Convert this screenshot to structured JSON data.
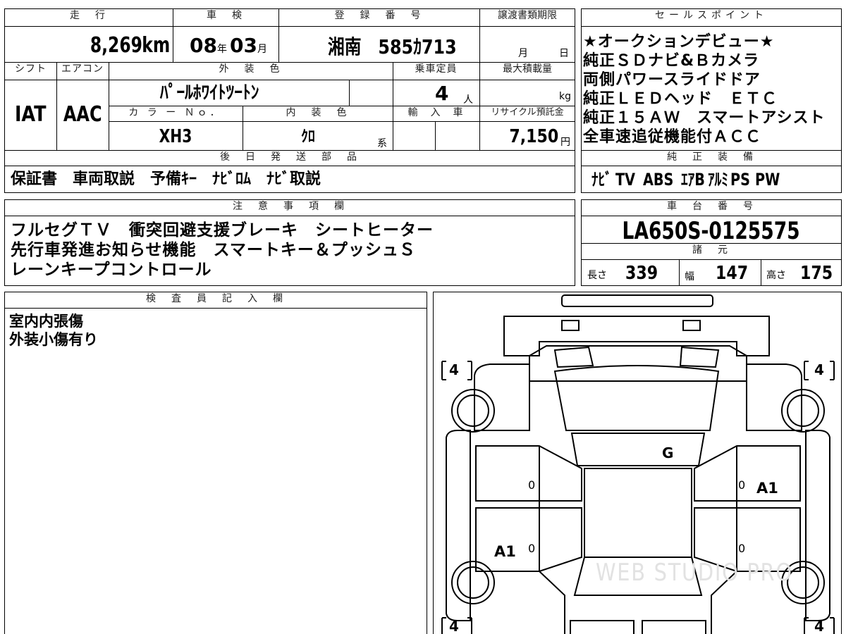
{
  "top": {
    "mileage_h": "走　行",
    "mileage_value": "8,269",
    "mileage_unit": "km",
    "inspect_h": "車　検",
    "inspect_year": "08",
    "inspect_year_unit": "年",
    "inspect_month": "03",
    "inspect_month_unit": "月",
    "reg_h": "登　録　番　号",
    "reg_value": "湘南　585ｶ713",
    "transfer_h": "譲渡書類期限",
    "transfer_month": "月",
    "transfer_day": "日",
    "shift_h": "シフト",
    "shift_value": "IAT",
    "ac_h": "エアコン",
    "ac_value": "AAC",
    "exterior_h": "外　装　色",
    "exterior_value": "ﾊﾟｰﾙﾎﾜｲﾄﾂｰﾄﾝ",
    "capacity_h": "乗車定員",
    "capacity_value": "4",
    "capacity_unit": "人",
    "maxload_h": "最大積載量",
    "maxload_unit": "kg",
    "colorno_h": "カ ラ ー Ｎｏ．",
    "colorno_value": "XH3",
    "interior_h": "内　装　色",
    "interior_value": "ｸﾛ",
    "interior_unit": "系",
    "import_h": "輸　入　車",
    "recycle_h": "リサイクル預託金",
    "recycle_value": "7,150",
    "recycle_unit": "円",
    "later_h": "後　日　発　送　部　品",
    "later_value": "保証書　車両取説　予備ｷｰ　ﾅﾋﾞﾛﾑ　ﾅﾋﾞ取説"
  },
  "sales": {
    "header": "セールスポイント",
    "lines": [
      "★オークションデビュー★",
      "純正ＳＤナビ&Ｂカメラ",
      "両側パワースライドドア",
      "純正ＬＥＤヘッド　ＥＴＣ",
      "純正１５ＡＷ　スマートアシスト",
      "全車速追従機能付ＡＣＣ"
    ],
    "equip_h": "純　正　装　備",
    "equip": [
      "ﾅﾋﾞ",
      "TV",
      "ABS",
      "ｴｱB",
      "ｱﾙﾐ",
      "PS",
      "PW"
    ]
  },
  "notes": {
    "header": "注　意　事　項　欄",
    "lines": [
      "フルセグＴＶ　衝突回避支援ブレーキ　シートヒーター",
      "先行車発進お知らせ機能　スマートキー＆プッシュＳ",
      "レーンキープコントロール"
    ]
  },
  "chassis": {
    "header": "車　台　番　号",
    "value": "LA650S-0125575",
    "spec_h": "諸　元",
    "length_label": "長さ",
    "length": "339",
    "width_label": "幅",
    "width": "147",
    "height_label": "高さ",
    "height": "175"
  },
  "inspector": {
    "header": "検　査　員　記　入　欄",
    "lines": [
      "室内内張傷",
      "外装小傷有り"
    ]
  },
  "diagram": {
    "tire_fl": "4",
    "tire_fr": "4",
    "tire_rl": "4",
    "tire_rr": "4",
    "mark_g": "G",
    "mark_a1_right": "A1",
    "mark_a1_left": "A1",
    "zero": "0",
    "watermark": "WEB STUDIO PRO"
  }
}
